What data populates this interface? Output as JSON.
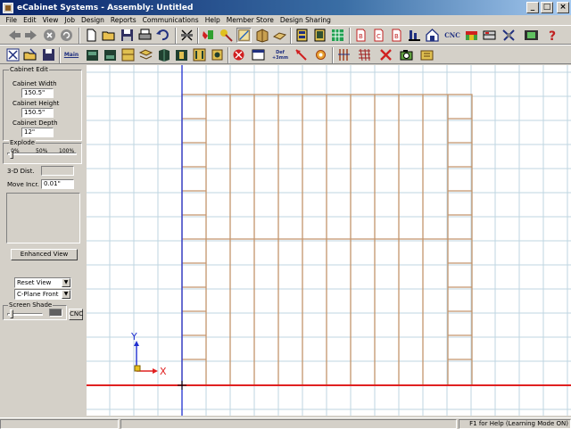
{
  "window": {
    "title": "eCabinet Systems - Assembly: Untitled",
    "minimize": "_",
    "maximize": "□",
    "close": "×"
  },
  "menu": [
    "File",
    "Edit",
    "View",
    "Job",
    "Design",
    "Reports",
    "Communications",
    "Help",
    "Member Store",
    "Design Sharing"
  ],
  "toolbar1": {
    "cnc_label": "CNC",
    "buttons": [
      "back-arrow-icon",
      "forward-arrow-icon",
      "stop-icon",
      "refresh-icon",
      "new-file-icon",
      "open-folder-icon",
      "save-icon",
      "print-icon",
      "undo-icon",
      "cut-icon",
      "paint-icon",
      "color-picker-icon",
      "draw-icon",
      "cabinet-icon",
      "panel-icon",
      "assembly-list-icon",
      "parts-list-icon",
      "grid-tool-icon",
      "report-icon",
      "report-c-icon",
      "report-b-icon",
      "tools-icon",
      "home-icon",
      "cnc-icon",
      "shop-icon",
      "materials-icon",
      "settings-icon",
      "film-icon",
      "help-icon"
    ]
  },
  "toolbar2": {
    "main_label": "Main",
    "def_label": "Def\n+3mm",
    "buttons": [
      "close-cabinet-icon",
      "open-cabinet-icon",
      "save-cabinet-icon",
      "main-icon",
      "cabinet-box-icon",
      "cabinet-face-icon",
      "cabinet-door-icon",
      "drawer-icon",
      "panel-tool-icon",
      "shelf-icon",
      "hardware-icon",
      "clamp-icon",
      "appliance-icon",
      "table-icon",
      "default-icon",
      "move-icon",
      "rotate-icon",
      "align-icon",
      "grid-icon",
      "delete-icon",
      "camera-icon",
      "template-icon"
    ]
  },
  "left_panel": {
    "cabinet_edit_title": "Cabinet Edit",
    "cabinet_width_label": "Cabinet Width",
    "cabinet_width_value": "150.5\"",
    "cabinet_height_label": "Cabinet Height",
    "cabinet_height_value": "150.5\"",
    "cabinet_depth_label": "Cabinet Depth",
    "cabinet_depth_value": "12\"",
    "explode_title": "Explode",
    "explode_ticks": [
      "0%",
      "50%",
      "100%"
    ],
    "dist_3d_label": "3-D Dist.",
    "dist_3d_value": "",
    "move_incr_label": "Move Incr.",
    "move_incr_value": "0.01\"",
    "enhanced_view_button": "Enhanced View",
    "reset_view_select": "Reset View",
    "cplane_select": "C-Plane Front",
    "screen_shade_title": "Screen Shade",
    "cnc_button": "CNC"
  },
  "canvas": {
    "axis_y_label": "Y",
    "axis_x_label": "X",
    "grid_color": "#bfd6e2",
    "cabinet_color": "#c4956c",
    "axis_red": "#e02020",
    "axis_blue": "#2030d0"
  },
  "status": {
    "help_text": "F1 for Help (Learning Mode ON)"
  }
}
